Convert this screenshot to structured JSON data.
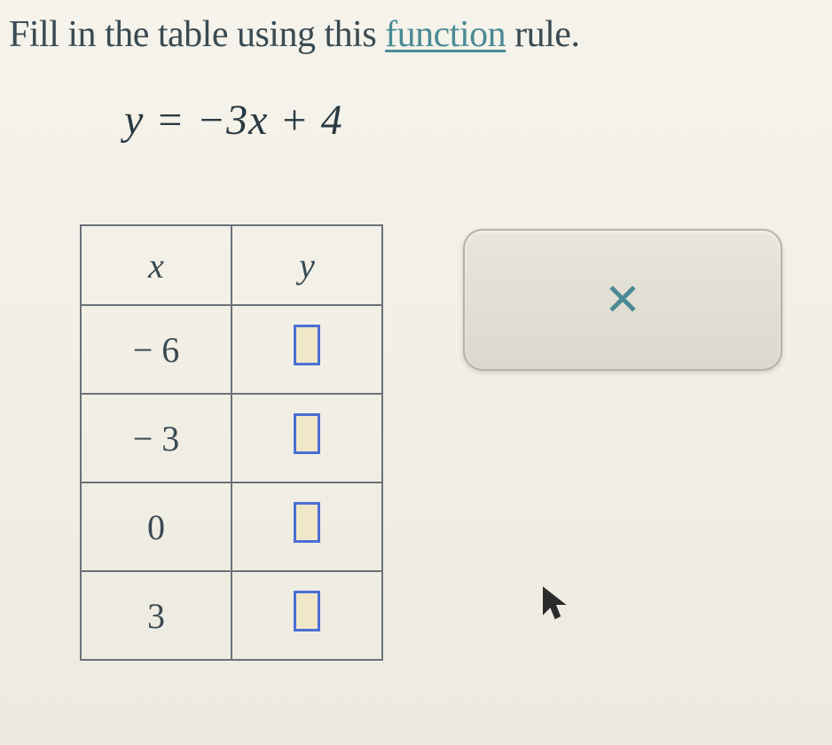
{
  "instruction": {
    "prefix": "Fill in the table using this ",
    "link_text": "function",
    "suffix": " rule."
  },
  "equation": "y = −3x + 4",
  "table": {
    "headers": {
      "col1": "x",
      "col2": "y"
    },
    "rows": [
      {
        "x": "− 6"
      },
      {
        "x": "− 3"
      },
      {
        "x": "0"
      },
      {
        "x": "3"
      }
    ]
  },
  "tool": {
    "close_symbol": "✕"
  }
}
